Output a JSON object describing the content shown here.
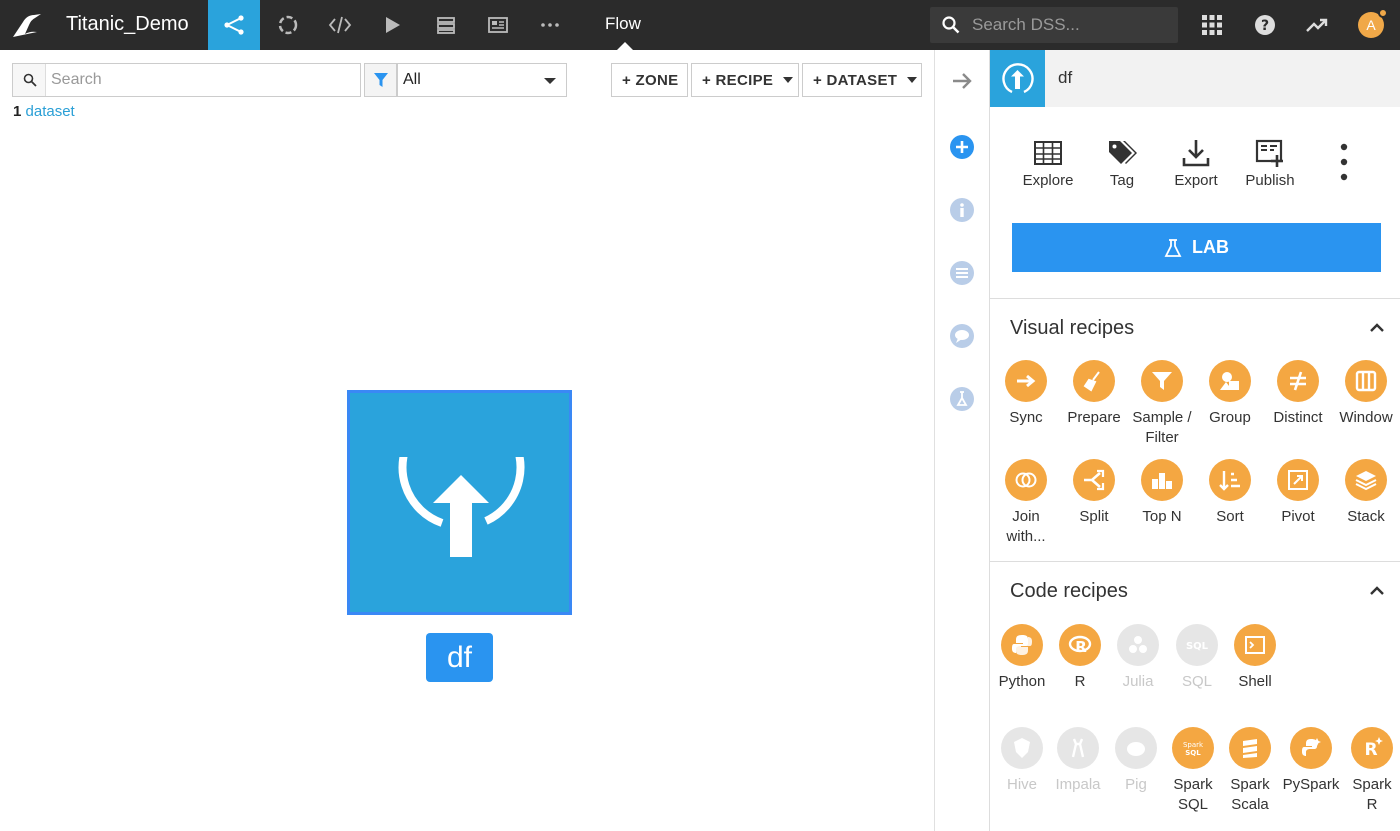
{
  "app": {
    "project_name": "Titanic_Demo",
    "section": "Flow"
  },
  "topbar": {
    "search_placeholder": "Search DSS...",
    "avatar_initial": "A"
  },
  "toolbar": {
    "search_placeholder": "Search",
    "filter_value": "All",
    "zone_label": "+ ZONE",
    "recipe_label": "+ RECIPE",
    "dataset_label": "+ DATASET"
  },
  "summary": {
    "count": "1",
    "kind": "dataset"
  },
  "flow": {
    "node_name": "df"
  },
  "panel": {
    "title": "df",
    "actions": [
      "Explore",
      "Tag",
      "Export",
      "Publish"
    ],
    "lab_label": "LAB",
    "visual_title": "Visual recipes",
    "visual_recipes": [
      {
        "label": "Sync",
        "icon": "sync-icon"
      },
      {
        "label": "Prepare",
        "icon": "broom-icon"
      },
      {
        "label": "Sample /\nFilter",
        "icon": "funnel-icon"
      },
      {
        "label": "Group",
        "icon": "group-icon"
      },
      {
        "label": "Distinct",
        "icon": "not-equal-icon"
      },
      {
        "label": "Window",
        "icon": "window-icon"
      },
      {
        "label": "Join\nwith...",
        "icon": "join-icon"
      },
      {
        "label": "Split",
        "icon": "split-icon"
      },
      {
        "label": "Top N",
        "icon": "podium-icon"
      },
      {
        "label": "Sort",
        "icon": "sort-icon"
      },
      {
        "label": "Pivot",
        "icon": "pivot-icon"
      },
      {
        "label": "Stack",
        "icon": "stack-icon"
      }
    ],
    "code_title": "Code recipes",
    "code_recipes": [
      {
        "label": "Python",
        "icon": "python-icon",
        "enabled": true
      },
      {
        "label": "R",
        "icon": "r-icon",
        "enabled": true
      },
      {
        "label": "Julia",
        "icon": "julia-icon",
        "enabled": false
      },
      {
        "label": "SQL",
        "icon": "sql-icon",
        "enabled": false
      },
      {
        "label": "Shell",
        "icon": "shell-icon",
        "enabled": true
      },
      {
        "label": "Hive",
        "icon": "hive-icon",
        "enabled": false
      },
      {
        "label": "Impala",
        "icon": "impala-icon",
        "enabled": false
      },
      {
        "label": "Pig",
        "icon": "pig-icon",
        "enabled": false
      },
      {
        "label": "Spark\nSQL",
        "icon": "spark-sql-icon",
        "enabled": true
      },
      {
        "label": "Spark\nScala",
        "icon": "spark-scala-icon",
        "enabled": true
      },
      {
        "label": "PySpark",
        "icon": "pyspark-icon",
        "enabled": true
      },
      {
        "label": "Spark\nR",
        "icon": "spark-r-icon",
        "enabled": true
      }
    ]
  },
  "colors": {
    "accent": "#2aa3dc",
    "button_blue": "#2a94f0",
    "recipe_orange": "#f4a742",
    "topbar": "#2b2b2b"
  }
}
